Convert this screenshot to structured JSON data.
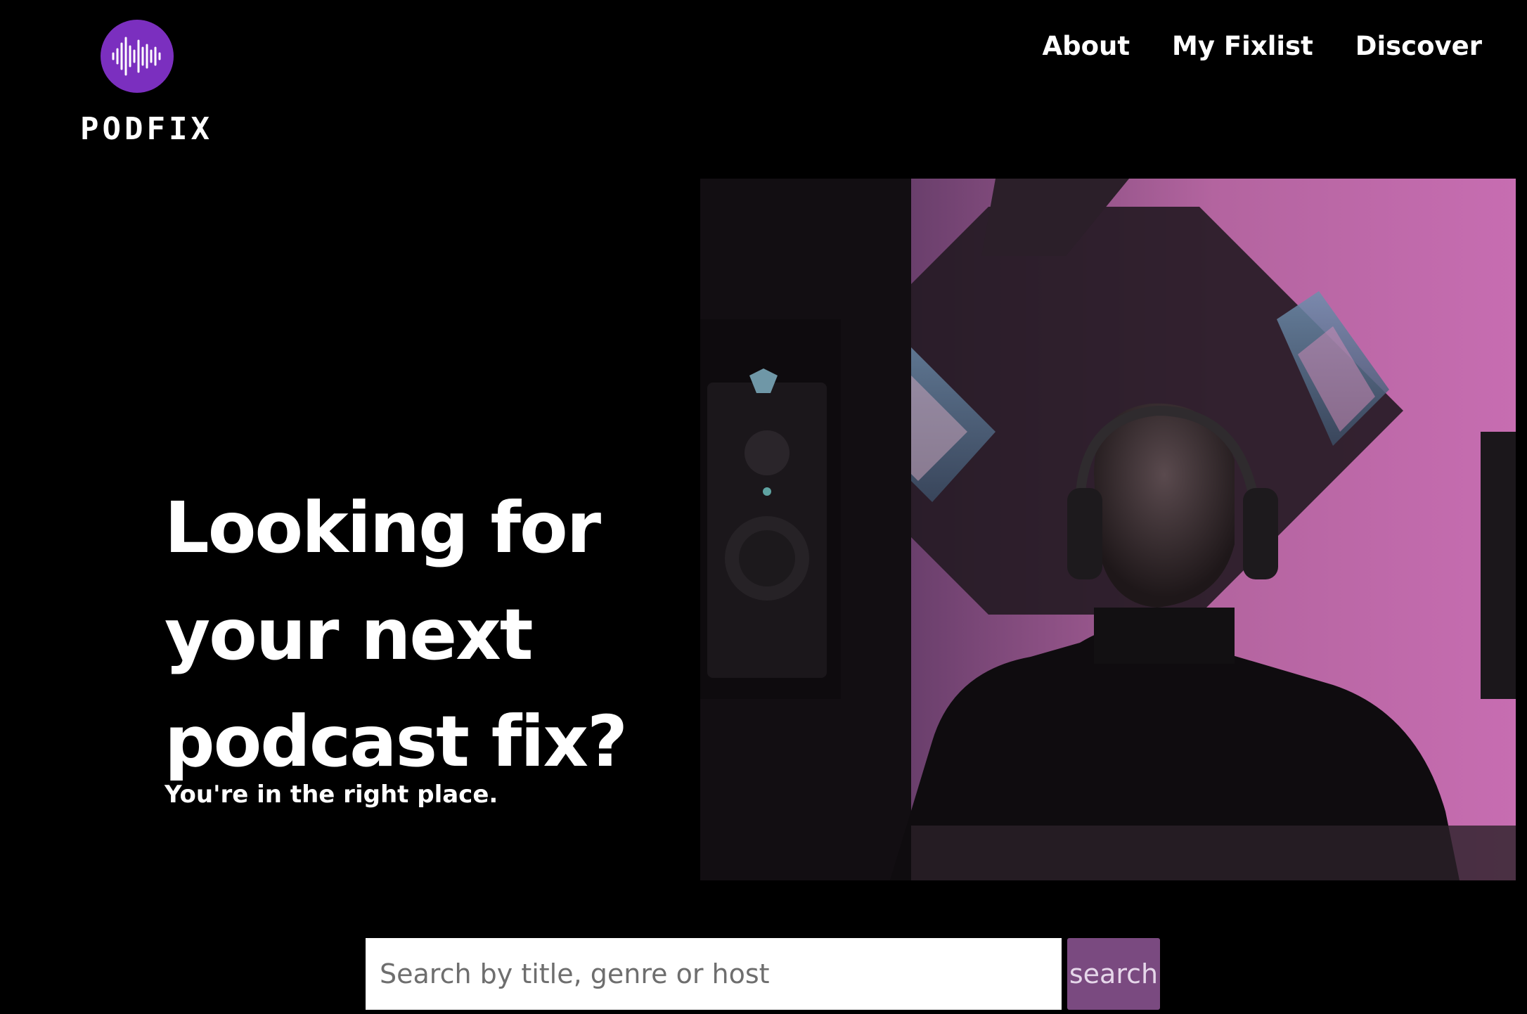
{
  "brand": {
    "logo_text": "PODFIX",
    "logo_icon": "soundwave-icon",
    "accent_color": "#7b2fbf"
  },
  "nav": {
    "items": [
      {
        "label": "About"
      },
      {
        "label": "My Fixlist"
      },
      {
        "label": "Discover"
      }
    ]
  },
  "hero": {
    "title_lines": [
      "Looking for",
      "your next",
      "podcast fix?"
    ],
    "subtitle": "You're in the right place.",
    "image": "person-wearing-headphones-in-studio-photo"
  },
  "search": {
    "placeholder": "Search by title, genre or host",
    "value": "",
    "button_label": "search",
    "button_color": "#7a4a80"
  }
}
